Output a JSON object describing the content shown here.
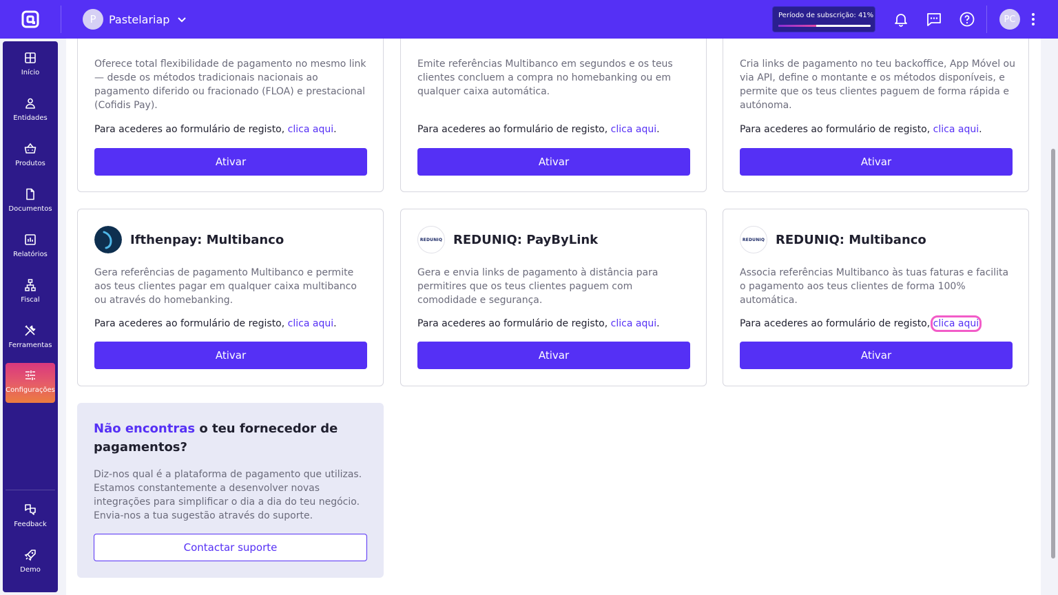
{
  "topbar": {
    "company_initial": "P",
    "company_name": "Pastelariap",
    "subscription_label": "Período de subscrição: 41%",
    "subscription_progress": 0.41,
    "user_initials": "PC"
  },
  "sidebar": {
    "items": [
      {
        "label": "Início",
        "icon": "grid-icon"
      },
      {
        "label": "Entidades",
        "icon": "user-icon"
      },
      {
        "label": "Produtos",
        "icon": "basket-icon"
      },
      {
        "label": "Documentos",
        "icon": "document-icon"
      },
      {
        "label": "Relatórios",
        "icon": "chart-icon"
      },
      {
        "label": "Fiscal",
        "icon": "hierarchy-icon"
      },
      {
        "label": "Ferramentas",
        "icon": "tools-icon"
      },
      {
        "label": "Configurações",
        "icon": "sliders-icon",
        "active": true
      }
    ],
    "bottom": [
      {
        "label": "Feedback",
        "icon": "feedback-icon"
      },
      {
        "label": "Demo",
        "icon": "rocket-icon"
      }
    ]
  },
  "cards": [
    {
      "desc": "Oferece total flexibilidade de pagamento no mesmo link — desde os métodos tradicionais nacionais ao pagamento diferido ou fracionado (FLOA) e prestacional (Cofidis Pay).",
      "reg_text": "Para acederes ao formulário de registo, ",
      "reg_link": "clica aqui",
      "reg_end": ".",
      "button": "Ativar"
    },
    {
      "desc": "Emite referências Multibanco em segundos e os teus clientes concluem a compra no homebanking ou em qualquer caixa automática.",
      "reg_text": "Para acederes ao formulário de registo, ",
      "reg_link": "clica aqui",
      "reg_end": ".",
      "button": "Ativar"
    },
    {
      "desc": "Cria links de pagamento no teu backoffice, App Móvel ou via API, define o montante e os métodos disponíveis, e permite que os teus clientes paguem de forma rápida e autónoma.",
      "reg_text": "Para acederes ao formulário de registo, ",
      "reg_link": "clica aqui",
      "reg_end": ".",
      "button": "Ativar"
    },
    {
      "title": "Ifthenpay: Multibanco",
      "desc": "Gera referências de pagamento Multibanco e permite aos teus clientes pagar em qualquer caixa multibanco ou através do homebanking.",
      "reg_text": "Para acederes ao formulário de registo, ",
      "reg_link": "clica aqui",
      "reg_end": ".",
      "button": "Ativar"
    },
    {
      "title": "REDUNIQ: PayByLink",
      "logo_text": "REDUNIQ",
      "desc": "Gera e envia links de pagamento à distância para permitires que os teus clientes paguem com comodidade e segurança.",
      "reg_text": "Para acederes ao formulário de registo, ",
      "reg_link": "clica aqui",
      "reg_end": ".",
      "button": "Ativar"
    },
    {
      "title": "REDUNIQ: Multibanco",
      "logo_text": "REDUNIQ",
      "desc": "Associa referências Multibanco às tuas faturas e facilita o pagamento aos teus clientes de forma 100% automática.",
      "reg_text": "Para acederes ao formulário de registo, ",
      "reg_link": "clica aqui",
      "reg_end": "",
      "button": "Ativar"
    }
  ],
  "suggest": {
    "accent": "Não encontras",
    "question": " o teu fornecedor de pagamentos?",
    "desc": "Diz-nos qual é a plataforma de pagamento que utilizas. Estamos constantemente a desenvolver novas integrações para simplificar o dia a dia do teu negócio. Envia-nos a tua sugestão através do suporte.",
    "button": "Contactar suporte"
  },
  "colors": {
    "brand": "#5530f5",
    "sidebar": "#2d1a8a",
    "highlight": "#f25cc8"
  }
}
